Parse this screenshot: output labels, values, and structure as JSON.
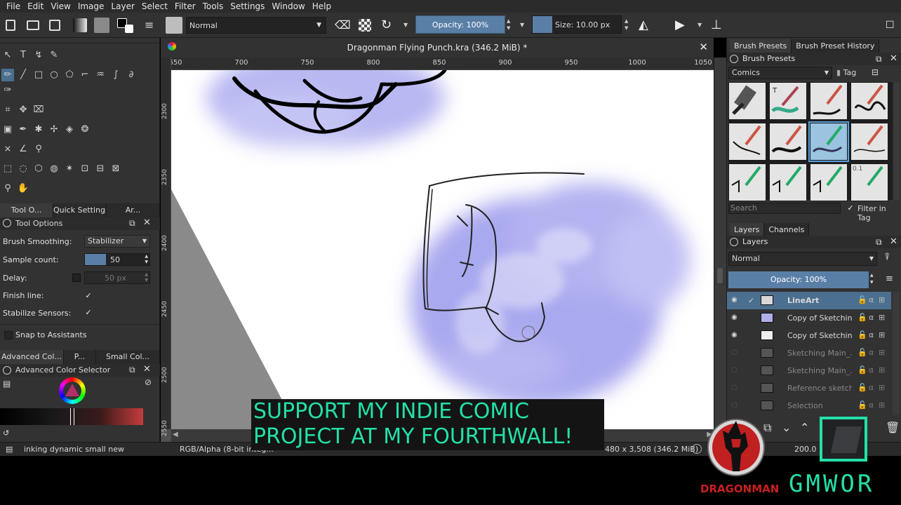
{
  "menu": [
    "File",
    "Edit",
    "View",
    "Image",
    "Layer",
    "Select",
    "Filter",
    "Tools",
    "Settings",
    "Window",
    "Help"
  ],
  "toolbar": {
    "blend_mode": "Normal",
    "opacity": "Opacity: 100%",
    "size": "Size: 10.00 px"
  },
  "document": {
    "title": "Dragonman Flying Punch.kra (346.2 MiB) *",
    "ruler_h": [
      "650",
      "700",
      "750",
      "800",
      "850",
      "900",
      "950",
      "1000",
      "1050"
    ],
    "ruler_v": [
      "2300",
      "2350",
      "2400",
      "2450",
      "2500",
      "2550"
    ]
  },
  "left_dock": {
    "tabs": [
      "Tool O...",
      "Quick Settings ...",
      "Ar..."
    ],
    "tool_options_title": "Tool Options",
    "brush_smoothing_label": "Brush Smoothing:",
    "brush_smoothing_value": "Stabilizer",
    "sample_count_label": "Sample count:",
    "sample_count_value": "50",
    "delay_label": "Delay:",
    "delay_value": "50 px",
    "finish_line_label": "Finish line:",
    "stabilize_sensors_label": "Stabilize Sensors:",
    "snap_label": "Snap to Assistants",
    "color_tabs": [
      "Advanced Col...",
      "P...",
      "Small Col..."
    ],
    "color_selector_title": "Advanced Color Selector"
  },
  "right_dock": {
    "preset_tabs": [
      "Brush Presets",
      "Brush Preset History"
    ],
    "presets_title": "Brush Presets",
    "preset_tag_filter": "Comics",
    "tag_button": "Tag",
    "search_placeholder": "Search",
    "filter_in_tag": "Filter in Tag",
    "preset_number_label": "0.1",
    "layer_tabs": [
      "Layers",
      "Channels"
    ],
    "layers_title": "Layers",
    "layer_blend": "Normal",
    "layer_opacity": "Opacity: 100%",
    "layers": [
      {
        "name": "LineArt",
        "visible": true,
        "active": true
      },
      {
        "name": "Copy of Sketchin...",
        "visible": true,
        "active": false
      },
      {
        "name": "Copy of Sketchin...",
        "visible": true,
        "active": false
      },
      {
        "name": "Sketching Main_...",
        "visible": false,
        "active": false
      },
      {
        "name": "Sketching Main_...",
        "visible": false,
        "active": false
      },
      {
        "name": "Reference sketch",
        "visible": false,
        "active": false
      },
      {
        "name": "Selection",
        "visible": false,
        "active": false
      }
    ]
  },
  "statusbar": {
    "preset_name": "inking dynamic small new",
    "color_model": "RGB/Alpha (8-bit integ...",
    "dimensions": "480 x 3,508 (346.2 MiB)",
    "zoom": "200.0"
  },
  "overlay": {
    "caption_line1": "SUPPORT MY INDIE COMIC",
    "caption_line2": "PROJECT AT MY FOURTHWALL!",
    "logo_left": "DRAGONMAN",
    "logo_right": "GMWOR"
  },
  "colors": {
    "caption_text": "#23e0a8",
    "accent": "#5aa0d8",
    "sketch_blue": "#a8a8f0"
  }
}
